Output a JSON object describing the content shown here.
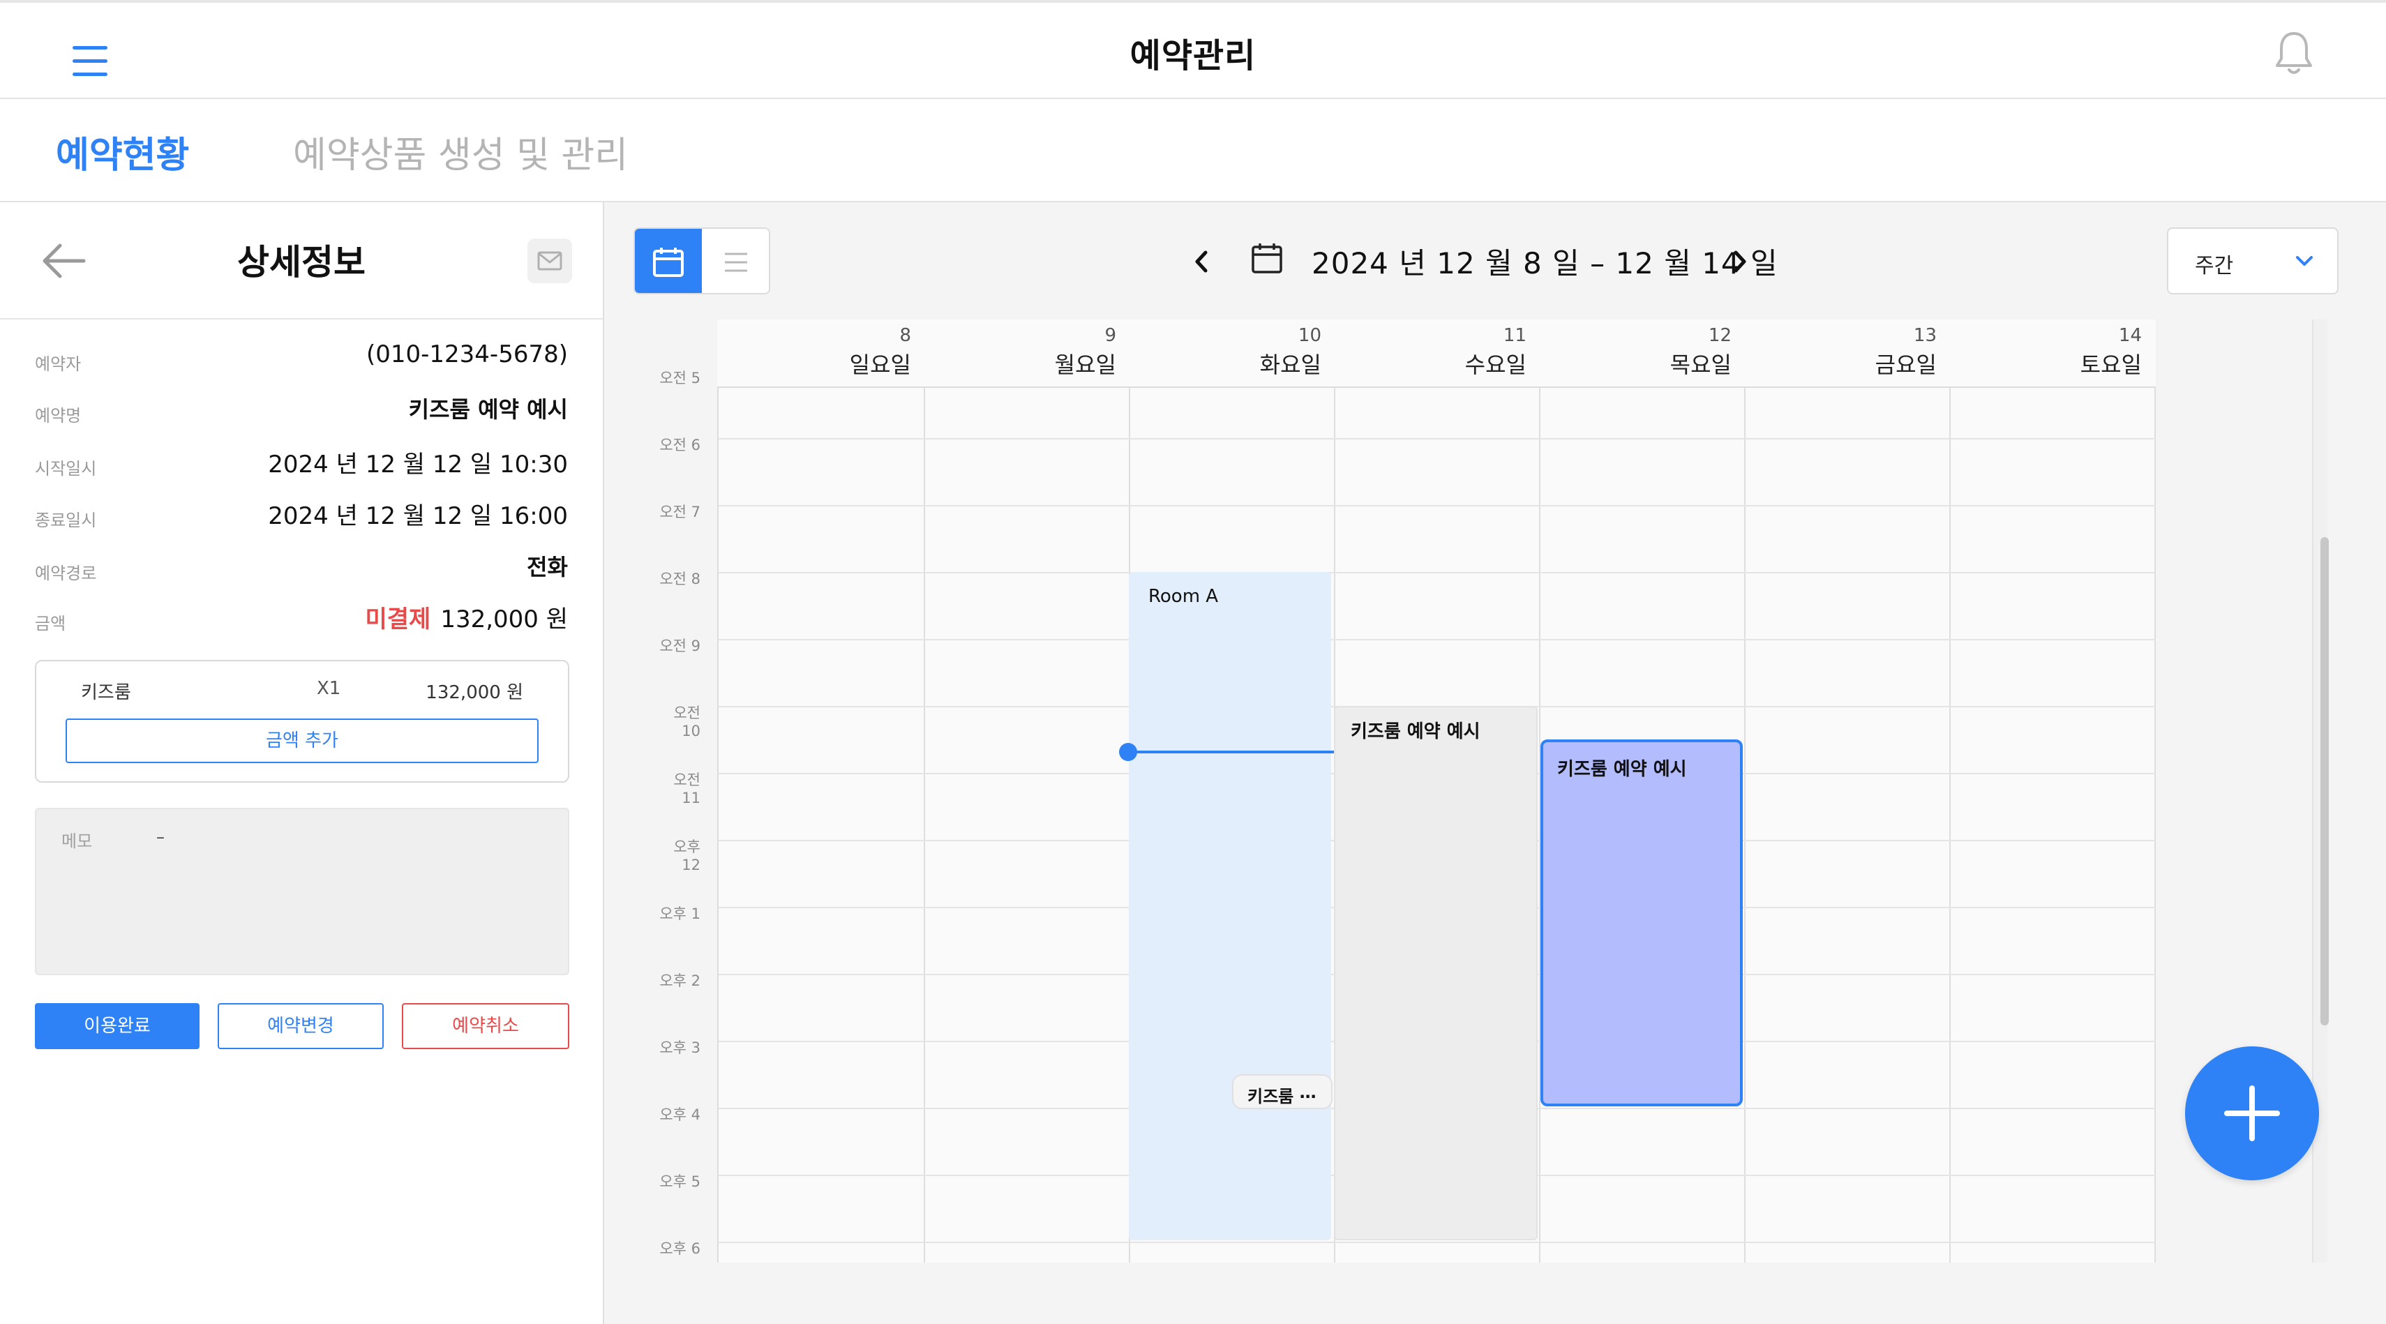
{
  "header": {
    "title": "예약관리"
  },
  "tabs": [
    {
      "label": "예약현황",
      "active": true
    },
    {
      "label": "예약상품 생성 및 관리",
      "active": false
    }
  ],
  "detail": {
    "title": "상세정보",
    "fields": [
      {
        "label": "예약자",
        "value": "(010-1234-5678)"
      },
      {
        "label": "예약명",
        "value": "키즈룸 예약 예시"
      },
      {
        "label": "시작일시",
        "value": "2024 년 12 월 12 일 10:30"
      },
      {
        "label": "종료일시",
        "value": "2024 년 12 월 12 일 16:00"
      },
      {
        "label": "예약경로",
        "value": "전화"
      },
      {
        "label": "금액",
        "status": "미결제",
        "value": "132,000 원"
      }
    ],
    "price_item": {
      "name": "키즈룸",
      "qty": "X1",
      "price": "132,000 원"
    },
    "add_amount_label": "금액 추가",
    "memo": {
      "label": "메모",
      "value": "–"
    },
    "actions": {
      "complete": "이용완료",
      "change": "예약변경",
      "cancel": "예약취소"
    }
  },
  "calendar": {
    "date_range": "2024 년 12 월 8 일 – 12 월 14 일",
    "period": "주간",
    "days": [
      {
        "num": "8",
        "name": "일요일"
      },
      {
        "num": "9",
        "name": "월요일"
      },
      {
        "num": "10",
        "name": "화요일"
      },
      {
        "num": "11",
        "name": "수요일"
      },
      {
        "num": "12",
        "name": "목요일"
      },
      {
        "num": "13",
        "name": "금요일"
      },
      {
        "num": "14",
        "name": "토요일"
      }
    ],
    "times": [
      "오전 5",
      "오전 6",
      "오전 7",
      "오전 8",
      "오전 9",
      "오전 10",
      "오전 11",
      "오후 12",
      "오후 1",
      "오후 2",
      "오후 3",
      "오후 4",
      "오후 5",
      "오후 6"
    ],
    "events": {
      "room_a": "Room A",
      "wed": "키즈룸 예약 예시",
      "thu": "키즈룸 예약 예시",
      "small": "키즈룸 ⋯"
    }
  },
  "colors": {
    "accent": "#2f82f5",
    "danger": "#e84a4a",
    "selected_event": "#b3bcfd"
  },
  "icons": [
    "menu-icon",
    "bell-icon",
    "back-arrow-icon",
    "mail-icon",
    "calendar-icon",
    "list-icon",
    "chevron-left-icon",
    "chevron-right-icon",
    "chevron-down-icon",
    "plus-icon"
  ]
}
